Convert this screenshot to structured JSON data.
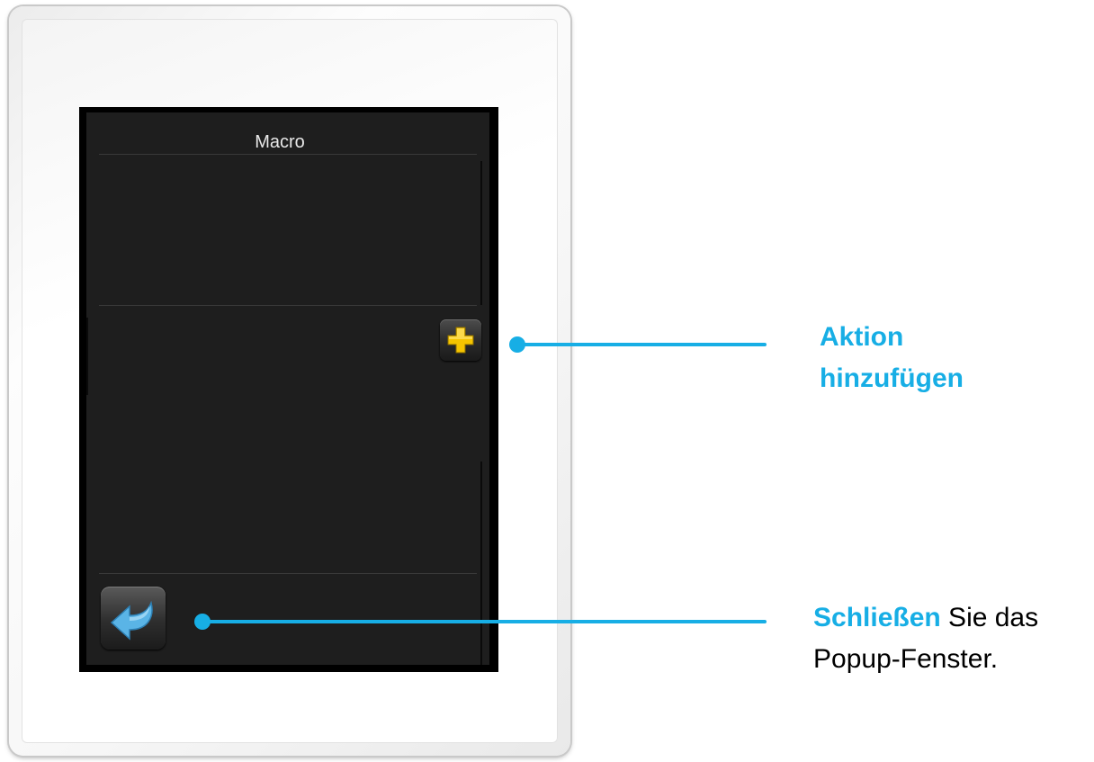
{
  "screen": {
    "title": "Macro"
  },
  "buttons": {
    "add_icon": "plus-icon",
    "back_icon": "back-arrow-icon"
  },
  "annotations": {
    "add": {
      "line1": "Aktion",
      "line2": "hinzufügen"
    },
    "close": {
      "highlight": "Schließen",
      "rest": " Sie das",
      "line2": "Popup-Fenster."
    }
  },
  "colors": {
    "accent": "#17aee5",
    "plus_yellow": "#f5c400",
    "arrow_blue": "#5ab4e6",
    "screen_bg": "#1e1e1e"
  }
}
